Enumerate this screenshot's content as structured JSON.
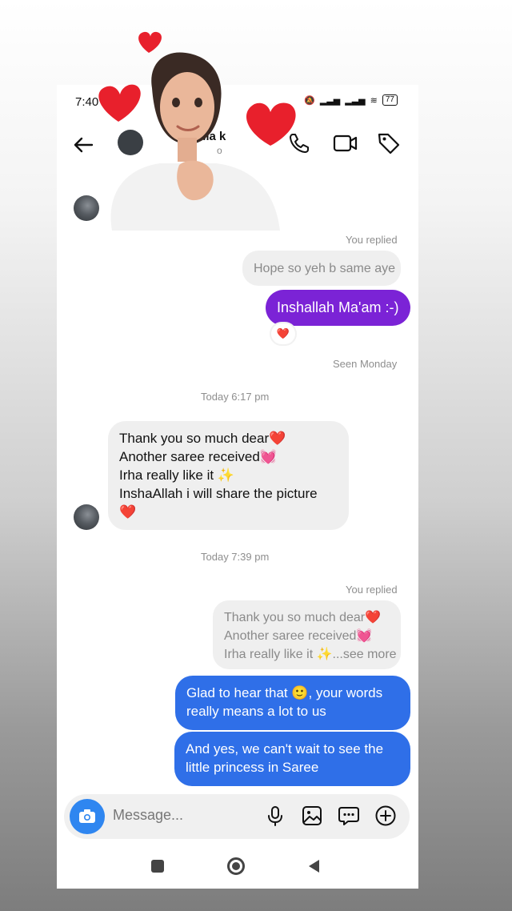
{
  "status_bar": {
    "time": "7:40",
    "battery": "77"
  },
  "header": {
    "name_fragment": "Ma k",
    "sub_fragment": "o"
  },
  "thread": [
    {
      "id": "quote1",
      "label": "You replied",
      "quoted_text": "Hope so yeh b same aye"
    },
    {
      "id": "sent1",
      "text": "Inshallah Ma'am :-)",
      "reaction": "❤️"
    },
    {
      "id": "seen",
      "text": "Seen Monday"
    },
    {
      "id": "ts1",
      "text": "Today 6:17 pm"
    },
    {
      "id": "recv1",
      "lines": [
        "Thank you so much dear❤️",
        "Another saree received💓",
        "Irha really like it ✨",
        "InshaAllah i will share the picture",
        "❤️"
      ]
    },
    {
      "id": "ts2",
      "text": "Today 7:39 pm"
    },
    {
      "id": "quote2",
      "label": "You replied",
      "lines": [
        "Thank you so much dear❤️",
        "Another saree received💓",
        "Irha really like it ✨...see more"
      ]
    },
    {
      "id": "sent2",
      "lines": [
        "Glad to hear that 🙂, your words",
        "really means a lot to us"
      ]
    },
    {
      "id": "sent3",
      "lines": [
        "And yes, we can't wait to see the",
        "little princess in Saree"
      ]
    }
  ],
  "composer": {
    "placeholder": "Message..."
  },
  "icons": [
    "back-arrow-icon",
    "phone-icon",
    "video-camera-icon",
    "tag-icon",
    "camera-icon",
    "microphone-icon",
    "gallery-icon",
    "chat-sticker-icon",
    "plus-circle-icon",
    "nav-square-icon",
    "nav-home-icon",
    "nav-back-icon"
  ],
  "colors": {
    "sent_purple": "#7b23d6",
    "sent_blue": "#2f6fe8",
    "received_bg": "#efefef",
    "camera_blue": "#2f86f0"
  }
}
